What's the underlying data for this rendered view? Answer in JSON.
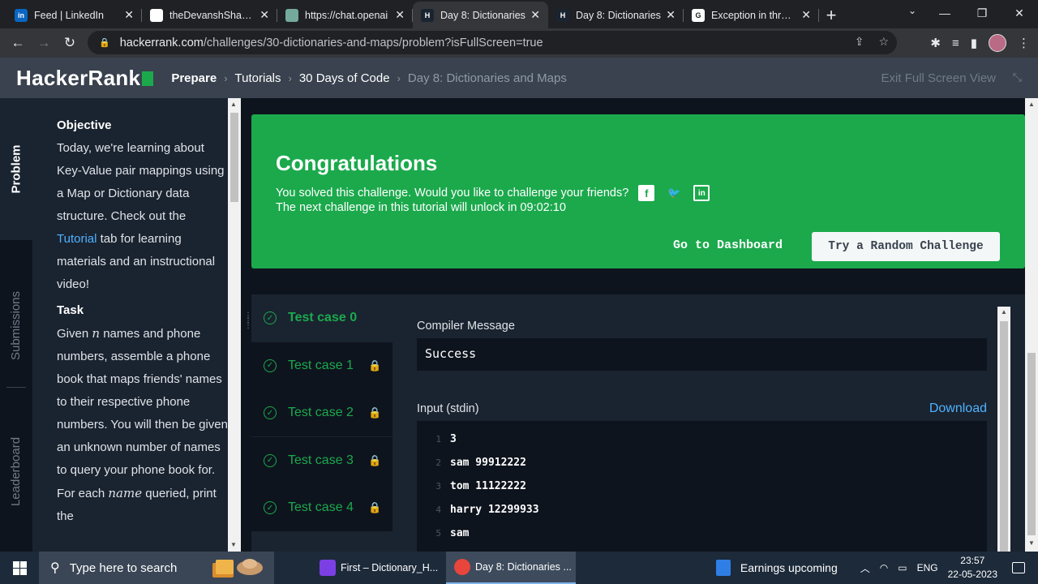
{
  "browser": {
    "tabs": [
      {
        "title": "Feed | LinkedIn",
        "favicon": "linkedin-icon",
        "color": "#0a66c2",
        "glyph": "in",
        "active": false
      },
      {
        "title": "theDevanshShah/D",
        "favicon": "github-icon",
        "color": "#ffffff",
        "glyph": "",
        "active": false
      },
      {
        "title": "https://chat.openai",
        "favicon": "openai-icon",
        "color": "#74aa9c",
        "glyph": "",
        "active": false
      },
      {
        "title": "Day 8: Dictionaries",
        "favicon": "hackerrank-icon",
        "color": "#1a2330",
        "glyph": "H",
        "active": true
      },
      {
        "title": "Day 8: Dictionaries",
        "favicon": "hackerrank-icon",
        "color": "#1a2330",
        "glyph": "H",
        "active": false
      },
      {
        "title": "Exception in thread",
        "favicon": "google-icon",
        "color": "#ffffff",
        "glyph": "G",
        "active": false
      }
    ],
    "url_host": "hackerrank.com",
    "url_path": "/challenges/30-dictionaries-and-maps/problem?isFullScreen=true"
  },
  "header": {
    "logo": "HackerRank",
    "breadcrumbs": [
      "Prepare",
      "Tutorials",
      "30 Days of Code",
      "Day 8: Dictionaries and Maps"
    ],
    "exit_fullscreen": "Exit Full Screen View"
  },
  "rail": {
    "problem": "Problem",
    "submissions": "Submissions",
    "leaderboard": "Leaderboard"
  },
  "problem": {
    "objective_heading": "Objective",
    "objective_pre": "Today, we're learning about Key-Value pair mappings using a Map or Dictionary data structure. Check out the",
    "objective_link": "Tutorial",
    "objective_post": "tab for learning materials and an instructional video!",
    "task_heading": "Task",
    "task_pre": "Given",
    "task_var": "n",
    "task_mid": "names and phone numbers, assemble a phone book that maps friends' names to their respective phone numbers. You will then be given an unknown number of names to query your phone book for. For each",
    "task_var2": "name",
    "task_post": "queried, print the"
  },
  "congrats": {
    "title": "Congratulations",
    "message": "You solved this challenge. Would you like to challenge your friends?",
    "unlock": "The next challenge in this tutorial will unlock in 09:02:10",
    "dashboard_button": "Go to Dashboard",
    "random_button": "Try a Random Challenge"
  },
  "results": {
    "test_cases": [
      {
        "label": "Test case 0",
        "locked": false,
        "active": true
      },
      {
        "label": "Test case 1",
        "locked": true,
        "active": false
      },
      {
        "label": "Test case 2",
        "locked": true,
        "active": false
      },
      {
        "label": "Test case 3",
        "locked": true,
        "active": false
      },
      {
        "label": "Test case 4",
        "locked": true,
        "active": false
      }
    ],
    "compiler_label": "Compiler Message",
    "compiler_message": "Success",
    "input_label": "Input (stdin)",
    "download": "Download",
    "input_lines": [
      {
        "n": "1",
        "text": "3"
      },
      {
        "n": "2",
        "text": "sam 99912222"
      },
      {
        "n": "3",
        "text": "tom 11122222"
      },
      {
        "n": "4",
        "text": "harry 12299933"
      },
      {
        "n": "5",
        "text": "sam"
      }
    ]
  },
  "taskbar": {
    "search_placeholder": "Type here to search",
    "apps": [
      {
        "title": "First – Dictionary_H...",
        "icon": "intellij-icon",
        "color": "#7b3fe4",
        "active": false
      },
      {
        "title": "Day 8: Dictionaries ...",
        "icon": "chrome-icon",
        "color": "#e8453c",
        "active": true
      }
    ],
    "news": "Earnings upcoming",
    "language": "ENG",
    "time": "23:57",
    "date": "22-05-2023"
  },
  "colors": {
    "success_green": "#1ba94c",
    "link_blue": "#4fb3ff",
    "header_bg": "#39424e"
  }
}
